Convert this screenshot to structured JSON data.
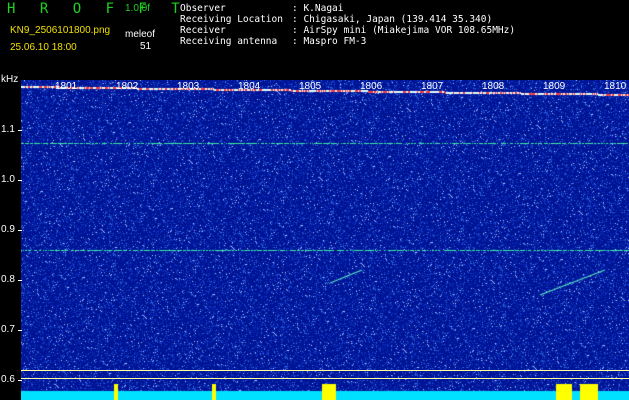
{
  "header": {
    "app_logo": "H R O F F T",
    "version": "1.0.0f",
    "filename": "KN9_2506101800.png",
    "software": "meleof",
    "datetime": "25.06.10 18:00",
    "count": "51"
  },
  "info": {
    "rows": [
      {
        "label": "Observer",
        "value": "K.Nagai"
      },
      {
        "label": "Receiving Location",
        "value": "Chigasaki, Japan (139.414 35.340)"
      },
      {
        "label": "Receiver",
        "value": "AirSpy mini (Miakejima VOR 108.65MHz)"
      },
      {
        "label": "Receiving antenna",
        "value": "Maspro FM-3"
      }
    ]
  },
  "axis": {
    "unit": "kHz",
    "y_ticks": [
      "1.1",
      "1.0",
      "0.9",
      "0.8",
      "0.7",
      "0.6"
    ],
    "time_labels": [
      "1801",
      "1802",
      "1803",
      "1804",
      "1805",
      "1806",
      "1807",
      "1808",
      "1809",
      "1810"
    ]
  },
  "colors": {
    "background_noise": "#0010a0",
    "signal": "#40ffa0",
    "bottom_band": "#00e0ff",
    "burst": "#ffff00"
  }
}
